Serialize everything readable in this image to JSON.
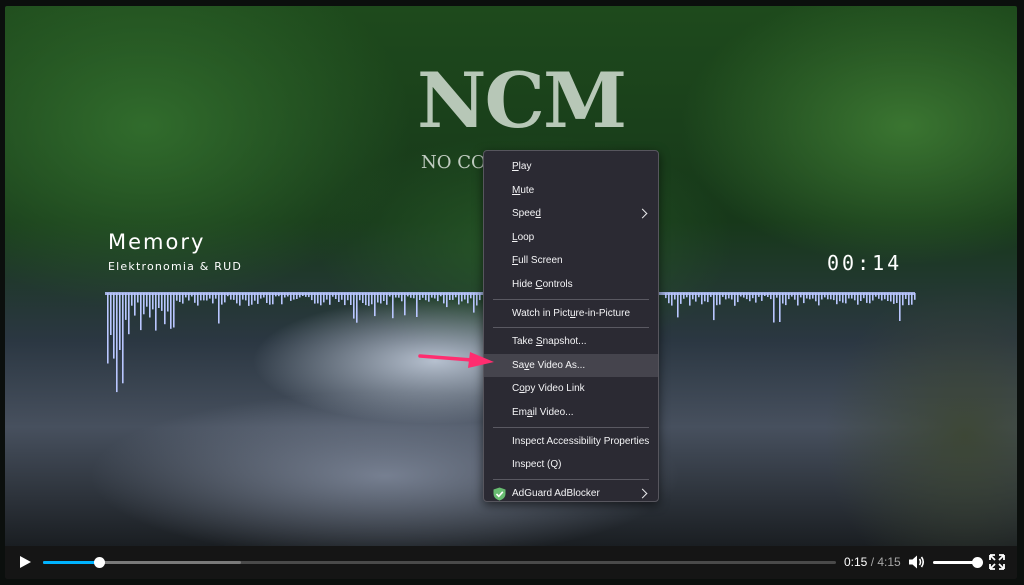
{
  "video": {
    "logo_text": "NCM",
    "logo_subtext": "NO COPY",
    "song_title": "Memory",
    "song_artist": "Elektronomia & RUD",
    "song_time": "00:14"
  },
  "context_menu": {
    "items": [
      {
        "pre": "",
        "u": "P",
        "post": "lay",
        "submenu": false
      },
      {
        "pre": "",
        "u": "M",
        "post": "ute",
        "submenu": false
      },
      {
        "pre": "Spee",
        "u": "d",
        "post": "",
        "submenu": true
      },
      {
        "pre": "",
        "u": "L",
        "post": "oop",
        "submenu": false
      },
      {
        "pre": "",
        "u": "F",
        "post": "ull Screen",
        "submenu": false
      },
      {
        "pre": "Hide ",
        "u": "C",
        "post": "ontrols",
        "submenu": false
      },
      {
        "pre": "Watch in Pict",
        "u": "u",
        "post": "re-in-Picture",
        "submenu": false
      },
      {
        "pre": "Take ",
        "u": "S",
        "post": "napshot...",
        "submenu": false
      },
      {
        "pre": "Sa",
        "u": "v",
        "post": "e Video As...",
        "submenu": false
      },
      {
        "pre": "C",
        "u": "o",
        "post": "py Video Link",
        "submenu": false
      },
      {
        "pre": "Em",
        "u": "a",
        "post": "il Video...",
        "submenu": false
      },
      {
        "pre": "Inspect Accessibility Properties",
        "u": "",
        "post": "",
        "submenu": false
      },
      {
        "pre": "Inspect (Q)",
        "u": "",
        "post": "",
        "submenu": false
      },
      {
        "pre": "AdGuard AdBlocker",
        "u": "",
        "post": "",
        "submenu": true
      }
    ],
    "highlighted_index": 8
  },
  "controls": {
    "current_time": "0:15",
    "separator": " / ",
    "duration": "4:15",
    "played_fraction": 0.07,
    "buffered_fraction": 0.25,
    "volume_fraction": 1.0
  },
  "colors": {
    "accent": "#00b3ff",
    "menu_bg": "#2b2a33",
    "menu_highlight": "#45444d",
    "annotation_arrow": "#ff2d6f",
    "visualizer": "#b9c6ff"
  },
  "icons": {
    "play": "play-icon",
    "volume": "volume-icon",
    "fullscreen": "fullscreen-icon",
    "adguard": "adguard-shield-icon",
    "submenu": "chevron-right-icon"
  }
}
